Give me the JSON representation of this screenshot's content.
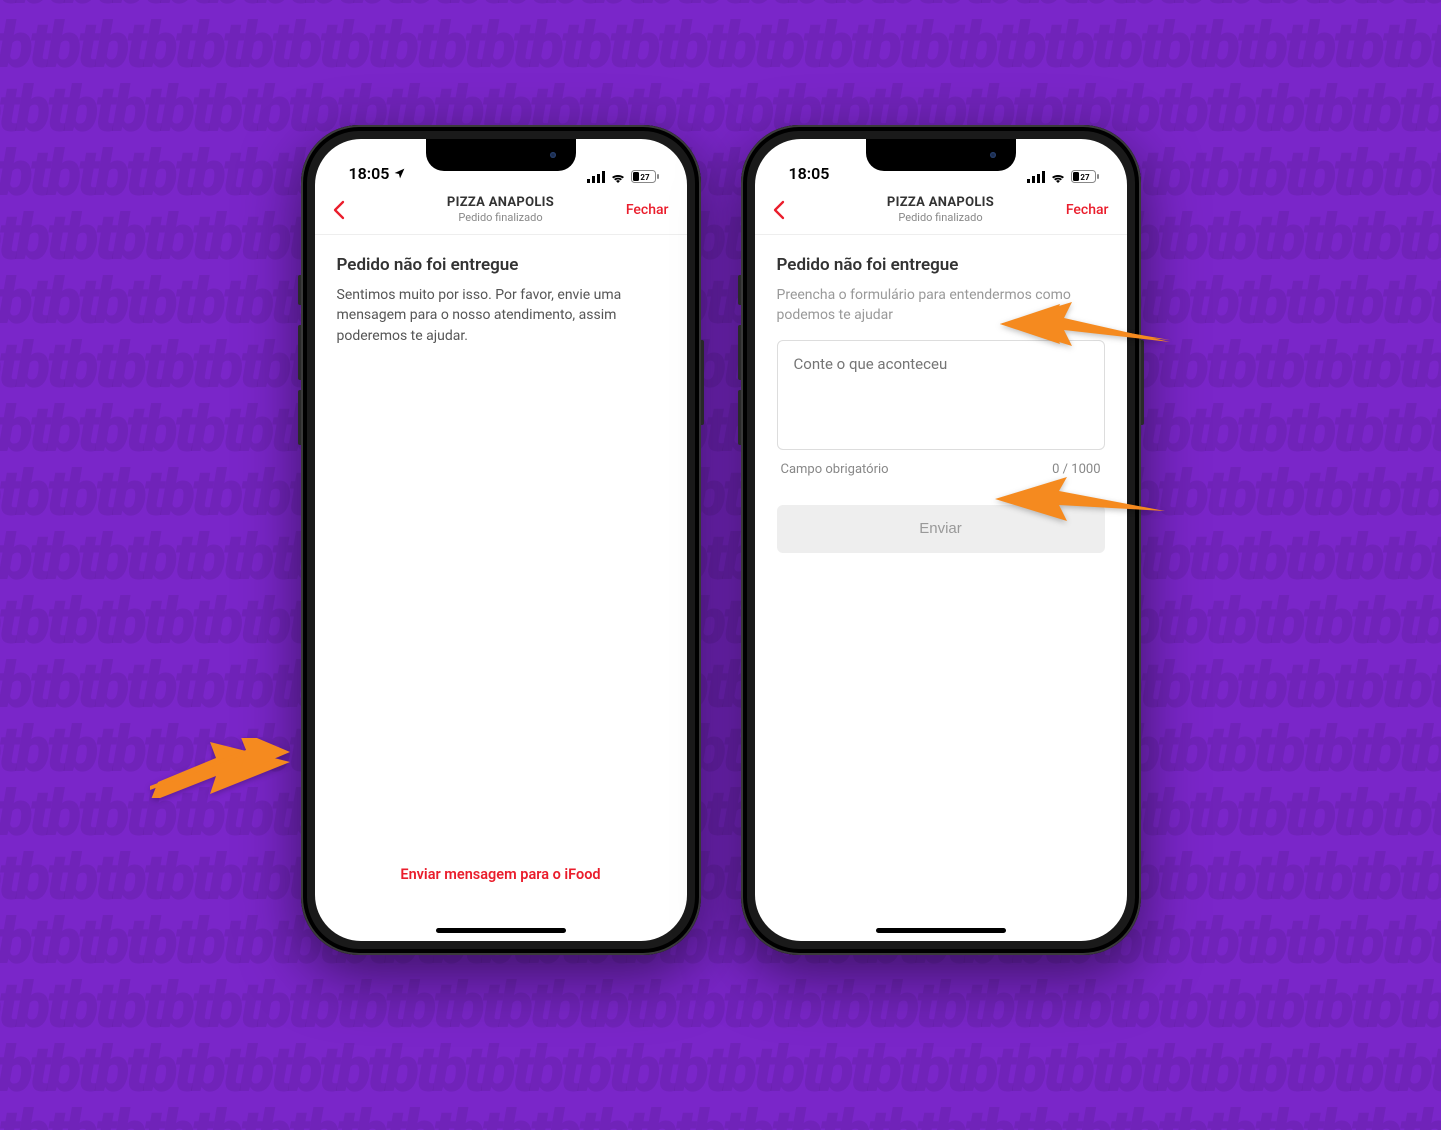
{
  "status_bar": {
    "time": "18:05",
    "battery_label": "27"
  },
  "navbar": {
    "title": "PIZZA ANAPOLIS",
    "subtitle": "Pedido finalizado",
    "close_label": "Fechar"
  },
  "screen1": {
    "heading": "Pedido não foi entregue",
    "body": "Sentimos muito por isso. Por favor, envie uma mensagem para o nosso atendimento, assim poderemos te ajudar.",
    "bottom_link": "Enviar mensagem para o iFood"
  },
  "screen2": {
    "heading": "Pedido não foi entregue",
    "intro": "Preencha o formulário para entendermos como podemos te ajudar",
    "placeholder": "Conte o que aconteceu",
    "required_label": "Campo obrigatório",
    "counter": "0 / 1000",
    "submit_label": "Enviar"
  },
  "bg_pattern_text": "tbtbtbtbtbtbtbtbtbtbtbtbtbtbtbtbtbtbtbtbtbtbtbtbtbtbtbtbtbtbtbtbtbtbtbtbtbtbtbtbtbtbtbtbtbtbtbtbtbtbtbtbtbtbtbtbtbtbtbtbtbtbtbtbtbtbtbtbtbtbtbtbtbtbtbtbtbtbtbtbtbtbtbtbtbtbtbtbtbtbtbtbtbtbtbtbtbtbtbtbtbtbtbtbtbtbtbtbtbtbtbtbtbtbtbtbtbtbtbtbtbtbtbtbtbtbtbtbtbtbtbtbtbtbtbtbtbtbtbtbtbtbtbtbtbtbtbtbtbtbtbtbtbtbtbtbtbtbtbtbtbtbtbtbtbtbtbtbtbtbtbtbtbtbtbtbtbtbtbtbtbtbtbtbtbtbtbtbtbtbtbtbtbtbtbtbtbtbtbtbtbtbtbtbtbtbtbtbtbtbtbtbtbtbtbtbtbtbtbtbtbtbtbtbtbtbtbtbtbtbtbtbtbtbtbtbtbtbtbtbtbtbtbtbtbtbtbtbtbtbtbtbtbtbtbtbtbtbtbtbtbtbtbtbtbtbtbtbtbtbtbtbtbtbtbtbtbtbtbtbtbtbtbtbtbtbtbtbtbtbtbtbtbtbtbtbtbtbtbtbtbtbtbtbtbtbtbtbtbtbtbtbtbtbtbtbtbtbtbtbtbtbtbtbtbtbtbtbtbtbtbtbtbtbtbtbtbtbtbtbtbtbtbtbtbtbtbtbtbtbtbtbtbtbtbtbtbtbtbtbtbtbtbtbtbtbtbtbtbtbtbtbtbtbtbtbtbtbtbtbtbtbtbtbtbtbtbtbtbtbtbtbtbtbtbtbtbtbtbtbtbtbtbtbtbtbtbtbtbtbtbtbtbtbtbtbtbtbtbtbtbtbtbtbtbtbtbtbtbtbtbtbtbtbtbtbtbtbtbtbtbtbtbtbtbtbtbtbtbtbtbtbtbtbtbtbtbtbtbtbtbtbtbtbtbtbtbtbtbtbtbtbtbtbtbtbtbtbtbtbtbtbtbtbtbtbtbtbtbtbtbtbtbtbtbtbtbtbtbtbtbtbtbtbtbtbtbtbtbtbtbtbtbtbtbtbtbtbtbtbtbtbtbtbtbtbtbtbtbtbtbtbtbtbtbtbtbtbtbtbtbtbtbtbtbtbtbtbtbtbtbtbtbtbtbtbtbtbtbtbtbtbtbtbtbtbtbtbtbtbtbtbtbtbtbtbtbtbtbtbtbtbtbtbtbtbtbtbtbtbtbtbtbtbtbtbtbtbtbtbtbtbtbtbtbtbtbtbtbtbtbtbtbtbtbtbtbtbtbtbtbtbtbtbtbtbtbtbtbtbtbtbtbtbtbtbtbtbtbtbtbtbtbtbtbtbtbtbtbtbtbtbtbtbtbtbtbtb"
}
